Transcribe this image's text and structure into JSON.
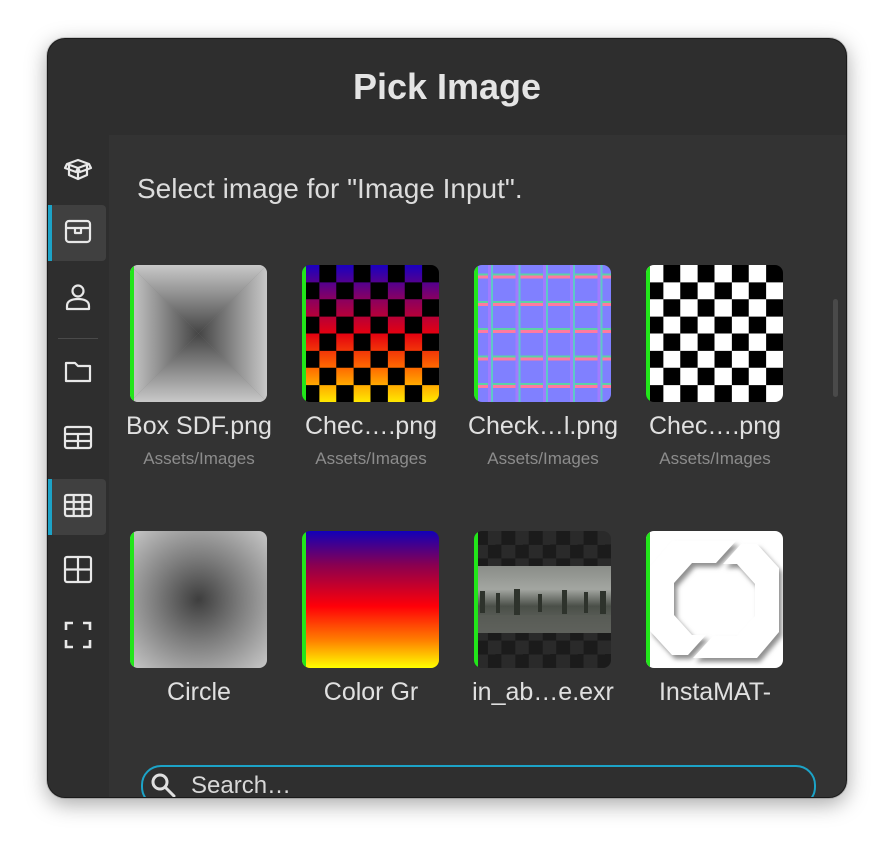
{
  "dialog": {
    "title": "Pick Image",
    "prompt": "Select image for \"Image Input\"."
  },
  "sidebar": {
    "items": [
      {
        "icon": "open-box-icon",
        "active": false
      },
      {
        "icon": "box-icon",
        "active": true
      },
      {
        "icon": "user-icon",
        "active": false
      },
      {
        "icon": "folder-icon",
        "active": false
      },
      {
        "icon": "table-icon",
        "active": false
      },
      {
        "icon": "grid-icon",
        "active": true
      },
      {
        "icon": "grid-2x2-icon",
        "active": false
      },
      {
        "icon": "fullscreen-icon",
        "active": false
      }
    ]
  },
  "images": [
    {
      "name": "Box SDF.png",
      "path": "Assets/Images"
    },
    {
      "name": "Chec….png",
      "path": "Assets/Images"
    },
    {
      "name": "Check…l.png",
      "path": "Assets/Images"
    },
    {
      "name": "Chec….png",
      "path": "Assets/Images"
    },
    {
      "name": "Circle",
      "path": ""
    },
    {
      "name": "Color Gr",
      "path": ""
    },
    {
      "name": "in_ab…e.exr",
      "path": ""
    },
    {
      "name": "InstaMAT-",
      "path": ""
    }
  ],
  "search": {
    "placeholder": "Search…",
    "value": ""
  },
  "colors": {
    "accent": "#1ca3c7",
    "thumb_marker": "#22e61a",
    "background": "#2e2e2e"
  }
}
